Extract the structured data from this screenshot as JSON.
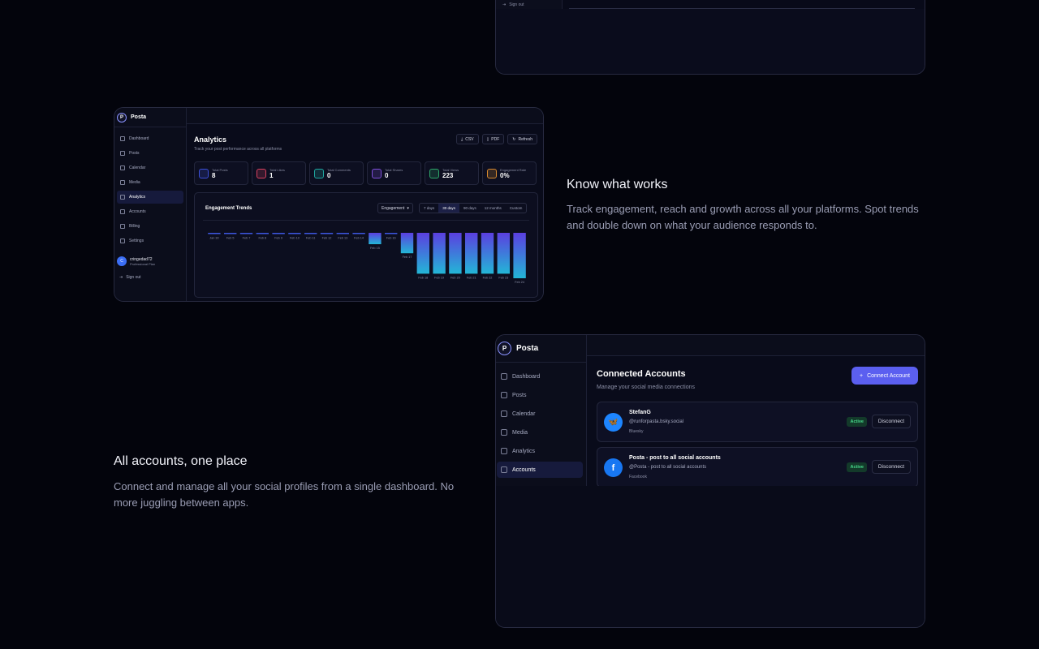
{
  "top_preview": {
    "signout_label": "Sign out"
  },
  "analytics_feature": {
    "title": "Know what works",
    "description": "Track engagement, reach and growth across all your platforms. Spot trends and double down on what your audience responds to."
  },
  "accounts_feature": {
    "title": "All accounts, one place",
    "description": "Connect and manage all your social profiles from a single dashboard. No more juggling between apps."
  },
  "analytics_app": {
    "brand": "Posta",
    "logo_letter": "P",
    "nav": [
      {
        "label": "Dashboard",
        "icon": "home-icon"
      },
      {
        "label": "Posts",
        "icon": "posts-icon"
      },
      {
        "label": "Calendar",
        "icon": "calendar-icon"
      },
      {
        "label": "Media",
        "icon": "media-icon"
      },
      {
        "label": "Analytics",
        "icon": "analytics-icon",
        "active": true
      },
      {
        "label": "Accounts",
        "icon": "link-icon"
      },
      {
        "label": "Billing",
        "icon": "card-icon"
      },
      {
        "label": "Settings",
        "icon": "gear-icon"
      }
    ],
    "user": {
      "avatar_letter": "C",
      "name": "cringedad72",
      "plan": "Professional Plan"
    },
    "signout_label": "Sign out",
    "title": "Analytics",
    "subtitle": "Track your post performance across all platforms",
    "actions": [
      {
        "label": "CSV",
        "icon": "download-icon"
      },
      {
        "label": "PDF",
        "icon": "file-icon"
      },
      {
        "label": "Refresh",
        "icon": "refresh-icon"
      }
    ],
    "stats": [
      {
        "label": "Total Posts",
        "value": "8",
        "color": "#3b4fd8"
      },
      {
        "label": "Total Likes",
        "value": "1",
        "color": "#d8415f"
      },
      {
        "label": "Total Comments",
        "value": "0",
        "color": "#1fa8a0"
      },
      {
        "label": "Total Shares",
        "value": "0",
        "color": "#7d4fd8"
      },
      {
        "label": "Total Views",
        "value": "223",
        "color": "#2ea86a"
      },
      {
        "label": "Engagement Rate",
        "value": "0%",
        "color": "#d88a2e"
      }
    ],
    "chart_title": "Engagement Trends",
    "metric_select": "Engagement",
    "ranges": [
      {
        "label": "7 days"
      },
      {
        "label": "30 days",
        "active": true
      },
      {
        "label": "90 days"
      },
      {
        "label": "12 months"
      },
      {
        "label": "Custom"
      }
    ]
  },
  "chart_data": {
    "type": "bar",
    "title": "Engagement Trends",
    "categories": [
      "Jan 30",
      "Feb 5",
      "Feb 7",
      "Feb 8",
      "Feb 9",
      "Feb 10",
      "Feb 11",
      "Feb 12",
      "Feb 13",
      "Feb 14",
      "Feb 15",
      "Feb 16",
      "Feb 17",
      "Feb 18",
      "Feb 19",
      "Feb 20",
      "Feb 21",
      "Feb 22",
      "Feb 23",
      "Feb 24"
    ],
    "values": [
      0,
      0,
      0,
      0,
      0,
      0,
      0,
      0,
      0,
      0,
      25,
      0,
      45,
      90,
      90,
      90,
      90,
      90,
      90,
      100
    ],
    "ylim": [
      0,
      100
    ],
    "bar_color_top": "#5b3fe0",
    "bar_color_bottom": "#23b6d6"
  },
  "accounts_app": {
    "brand": "Posta",
    "logo_letter": "P",
    "nav": [
      {
        "label": "Dashboard",
        "icon": "home-icon"
      },
      {
        "label": "Posts",
        "icon": "posts-icon"
      },
      {
        "label": "Calendar",
        "icon": "calendar-icon"
      },
      {
        "label": "Media",
        "icon": "media-icon"
      },
      {
        "label": "Analytics",
        "icon": "analytics-icon"
      },
      {
        "label": "Accounts",
        "icon": "link-icon",
        "active": true
      }
    ],
    "title": "Connected Accounts",
    "subtitle": "Manage your social media connections",
    "connect_label": "Connect Account",
    "accounts": [
      {
        "name": "StefanG",
        "handle": "@runforpasta.bsky.social",
        "platform": "Bluesky",
        "status": "Active",
        "action": "Disconnect",
        "icon_color": "#1d85ff"
      },
      {
        "name": "Posta - post to all social accounts",
        "handle": "@Posta - post to all social accounts",
        "platform": "Facebook",
        "status": "Active",
        "action": "Disconnect",
        "icon_color": "#1877f2"
      }
    ],
    "accent_color": "#5b5ff0"
  }
}
